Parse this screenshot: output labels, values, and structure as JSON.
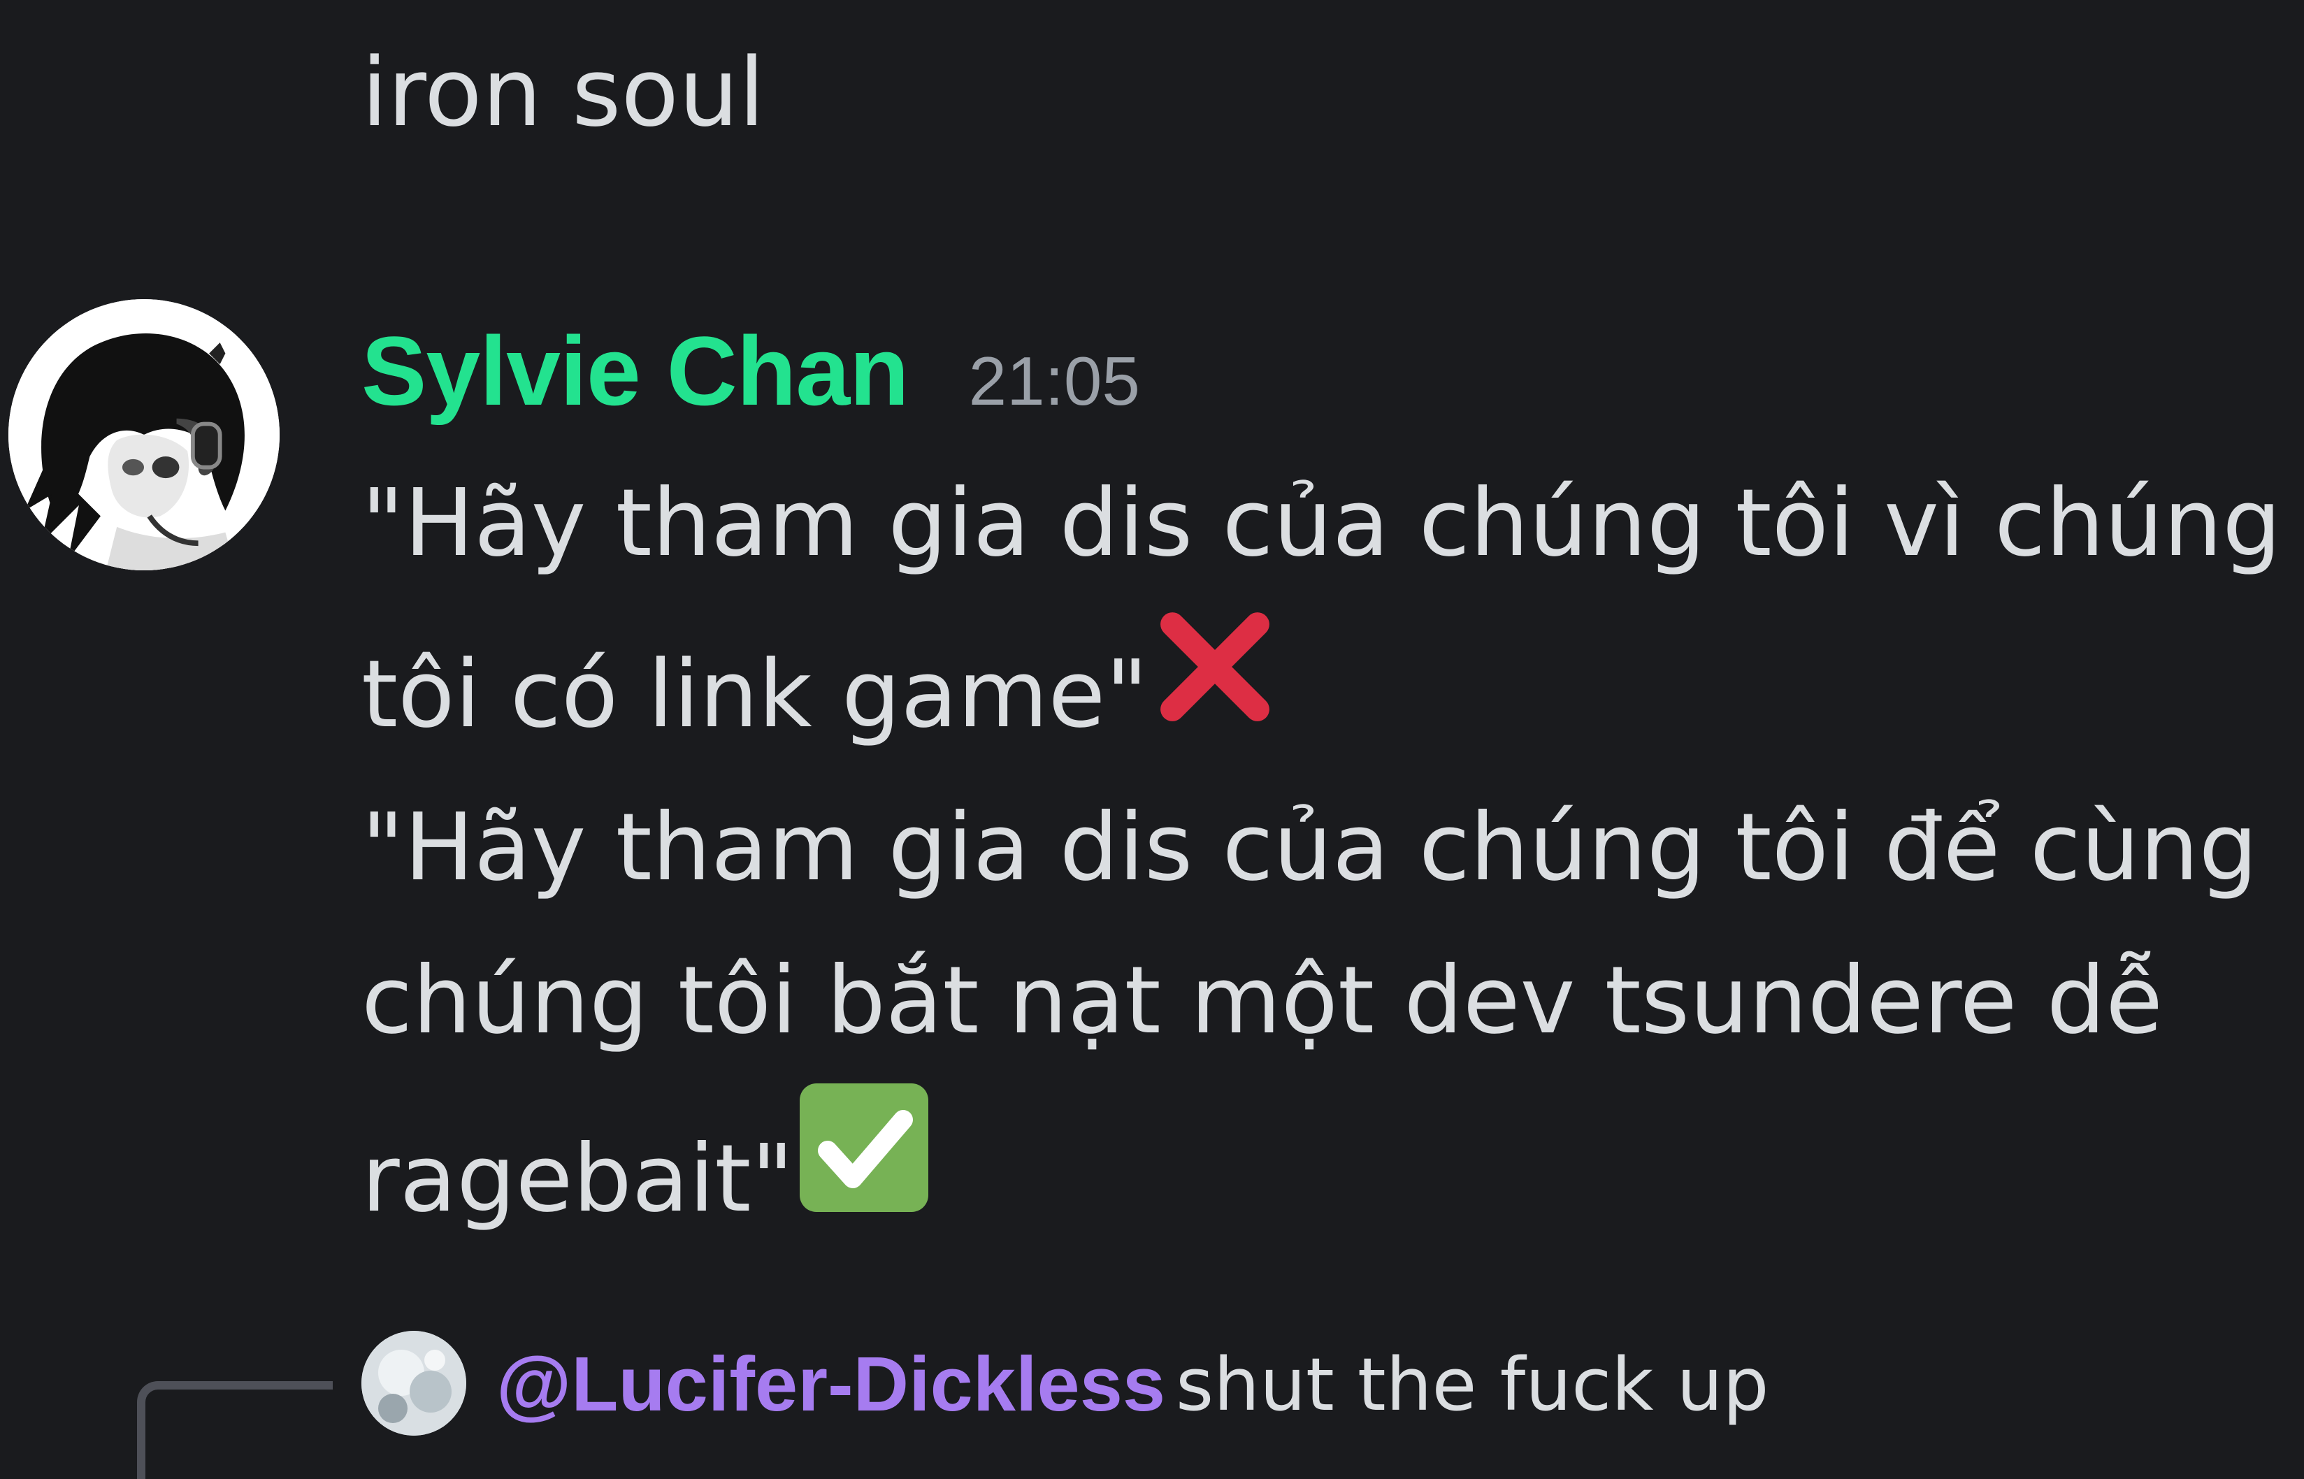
{
  "colors": {
    "background": "#1a1b1e",
    "username": "#23e28f",
    "timestamp": "#9aa0a8",
    "message_text": "#dbdee1",
    "mention": "#a67cf0",
    "cross_mark": "#dd2e44",
    "check_mark_bg": "#77b255"
  },
  "previous_message": {
    "text": "iron soul"
  },
  "message": {
    "author": "Sylvie Chan",
    "timestamp": "21:05",
    "avatar_icon": "anime-girl-avatar",
    "lines": [
      "\"Hãy tham gia dis của chúng tôi vì chúng",
      "tôi có link game\"",
      "\"Hãy tham gia dis của chúng tôi để cùng",
      "chúng tôi bắt nạt một dev tsundere dễ",
      "ragebait\""
    ],
    "emojis": {
      "line2": "cross-mark-emoji",
      "line5": "check-mark-button-emoji"
    }
  },
  "reply_preview": {
    "mention": "@Lucifer-Dickless",
    "text": "shut the fuck up",
    "avatar_icon": "user-avatar"
  }
}
